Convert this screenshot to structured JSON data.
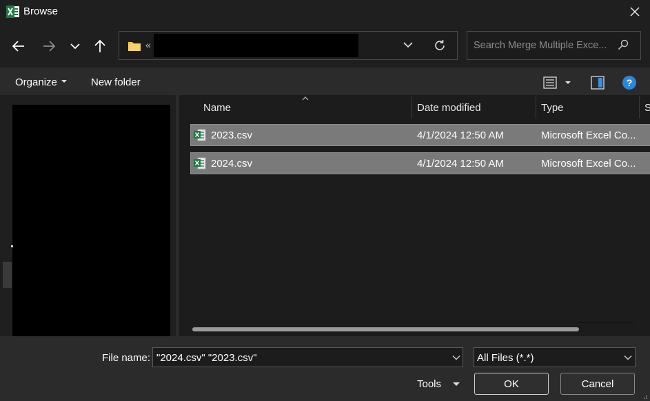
{
  "window": {
    "title": "Browse",
    "close_glyph": "✕"
  },
  "nav": {
    "back_glyph": "←",
    "forward_glyph": "→",
    "address_overflow": "«",
    "search_placeholder": "Search Merge Multiple Exce..."
  },
  "toolbar": {
    "organize_label": "Organize",
    "new_folder_label": "New folder",
    "help_glyph": "?"
  },
  "columns": {
    "name": "Name",
    "date": "Date modified",
    "type": "Type",
    "size": "S"
  },
  "files": [
    {
      "name": "2023.csv",
      "date": "4/1/2024 12:50 AM",
      "type": "Microsoft Excel Co..."
    },
    {
      "name": "2024.csv",
      "date": "4/1/2024 12:50 AM",
      "type": "Microsoft Excel Co..."
    }
  ],
  "bottom": {
    "file_name_label": "File name:",
    "file_name_value": "\"2024.csv\" \"2023.csv\"",
    "file_type_value": "All Files (*.*)",
    "tools_label": "Tools",
    "ok_label": "OK",
    "cancel_label": "Cancel"
  },
  "colors": {
    "excel_green": "#1f7a45",
    "folder_yellow": "#f1c34a",
    "help_blue": "#2b88d8",
    "selection": "#7a7a7a"
  }
}
